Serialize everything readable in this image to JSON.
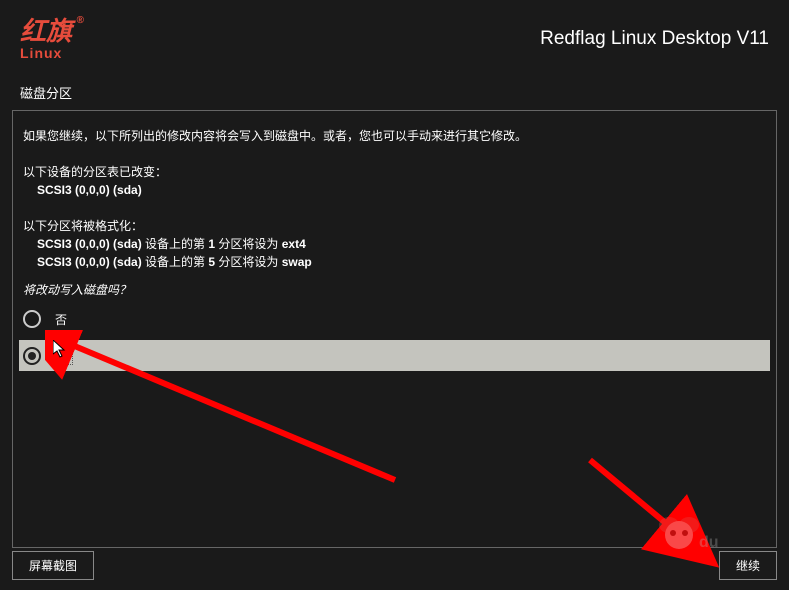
{
  "header": {
    "logo_main": "红旗",
    "logo_sub": "Linux",
    "title": "Redflag Linux Desktop V11"
  },
  "page_label": "磁盘分区",
  "content": {
    "intro": "如果您继续，以下所列出的修改内容将会写入到磁盘中。或者，您也可以手动来进行其它修改。",
    "section1_label": "以下设备的分区表已改变：",
    "device1": "SCSI3 (0,0,0) (sda)",
    "section2_label": "以下分区将被格式化：",
    "format1_prefix": "SCSI3 (0,0,0) (sda) ",
    "format1_mid": "设备上的第 ",
    "format1_num": "1 ",
    "format1_suffix": "分区将设为 ",
    "format1_fs": "ext4",
    "format2_prefix": "SCSI3 (0,0,0) (sda) ",
    "format2_mid": "设备上的第 ",
    "format2_num": "5 ",
    "format2_suffix": "分区将设为 ",
    "format2_fs": "swap",
    "confirm_question": "将改动写入磁盘吗？",
    "option_no": "否",
    "option_yes": "是"
  },
  "footer": {
    "screenshot_btn": "屏幕截图",
    "continue_btn": "继续"
  }
}
